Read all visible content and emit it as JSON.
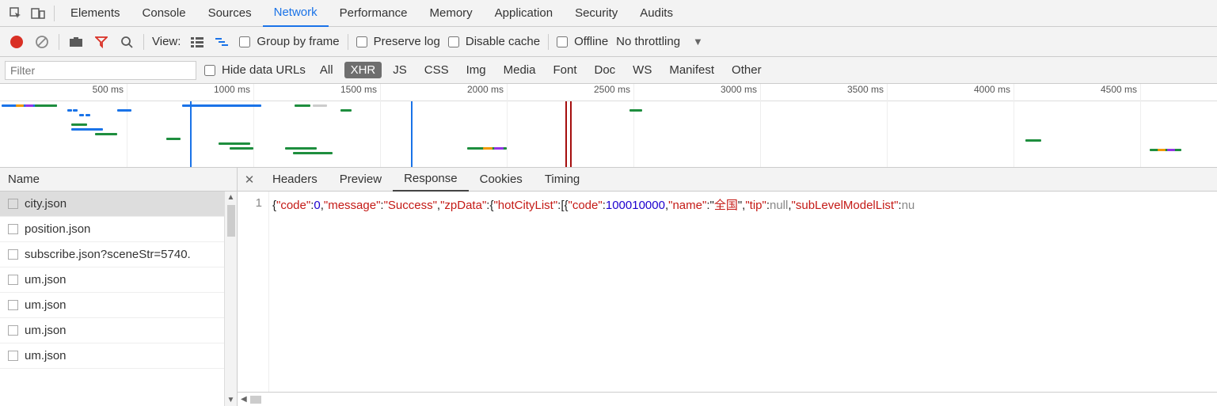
{
  "tabs": {
    "items": [
      "Elements",
      "Console",
      "Sources",
      "Network",
      "Performance",
      "Memory",
      "Application",
      "Security",
      "Audits"
    ],
    "active": "Network"
  },
  "toolbar": {
    "view_label": "View:",
    "group_by_frame": "Group by frame",
    "preserve_log": "Preserve log",
    "disable_cache": "Disable cache",
    "offline": "Offline",
    "throttling": "No throttling"
  },
  "filter": {
    "placeholder": "Filter",
    "hide_data_urls": "Hide data URLs",
    "types": [
      "All",
      "XHR",
      "JS",
      "CSS",
      "Img",
      "Media",
      "Font",
      "Doc",
      "WS",
      "Manifest",
      "Other"
    ],
    "selected": "XHR"
  },
  "timeline": {
    "ticks": [
      "500 ms",
      "1000 ms",
      "1500 ms",
      "2000 ms",
      "2500 ms",
      "3000 ms",
      "3500 ms",
      "4000 ms",
      "4500 ms"
    ]
  },
  "requests": {
    "header": "Name",
    "items": [
      "city.json",
      "position.json",
      "subscribe.json?sceneStr=5740.",
      "um.json",
      "um.json",
      "um.json",
      "um.json"
    ],
    "selected_index": 0
  },
  "detail": {
    "tabs": [
      "Headers",
      "Preview",
      "Response",
      "Cookies",
      "Timing"
    ],
    "active": "Response",
    "line_no": "1",
    "response_tokens": [
      {
        "t": "brace",
        "v": "{"
      },
      {
        "t": "key",
        "v": "\"code\""
      },
      {
        "t": "brace",
        "v": ":"
      },
      {
        "t": "num",
        "v": "0"
      },
      {
        "t": "brace",
        "v": ","
      },
      {
        "t": "key",
        "v": "\"message\""
      },
      {
        "t": "brace",
        "v": ":"
      },
      {
        "t": "str",
        "v": "\"Success\""
      },
      {
        "t": "brace",
        "v": ","
      },
      {
        "t": "key",
        "v": "\"zpData\""
      },
      {
        "t": "brace",
        "v": ":{"
      },
      {
        "t": "key",
        "v": "\"hotCityList\""
      },
      {
        "t": "brace",
        "v": ":[{"
      },
      {
        "t": "key",
        "v": "\"code\""
      },
      {
        "t": "brace",
        "v": ":"
      },
      {
        "t": "num",
        "v": "100010000"
      },
      {
        "t": "brace",
        "v": ","
      },
      {
        "t": "key",
        "v": "\"name\""
      },
      {
        "t": "brace",
        "v": ":\""
      },
      {
        "t": "cjk",
        "v": "全国"
      },
      {
        "t": "brace",
        "v": "\","
      },
      {
        "t": "key",
        "v": "\"tip\""
      },
      {
        "t": "brace",
        "v": ":"
      },
      {
        "t": "null",
        "v": "null"
      },
      {
        "t": "brace",
        "v": ","
      },
      {
        "t": "key",
        "v": "\"subLevelModelList\""
      },
      {
        "t": "brace",
        "v": ":"
      },
      {
        "t": "null",
        "v": "nu"
      }
    ]
  }
}
